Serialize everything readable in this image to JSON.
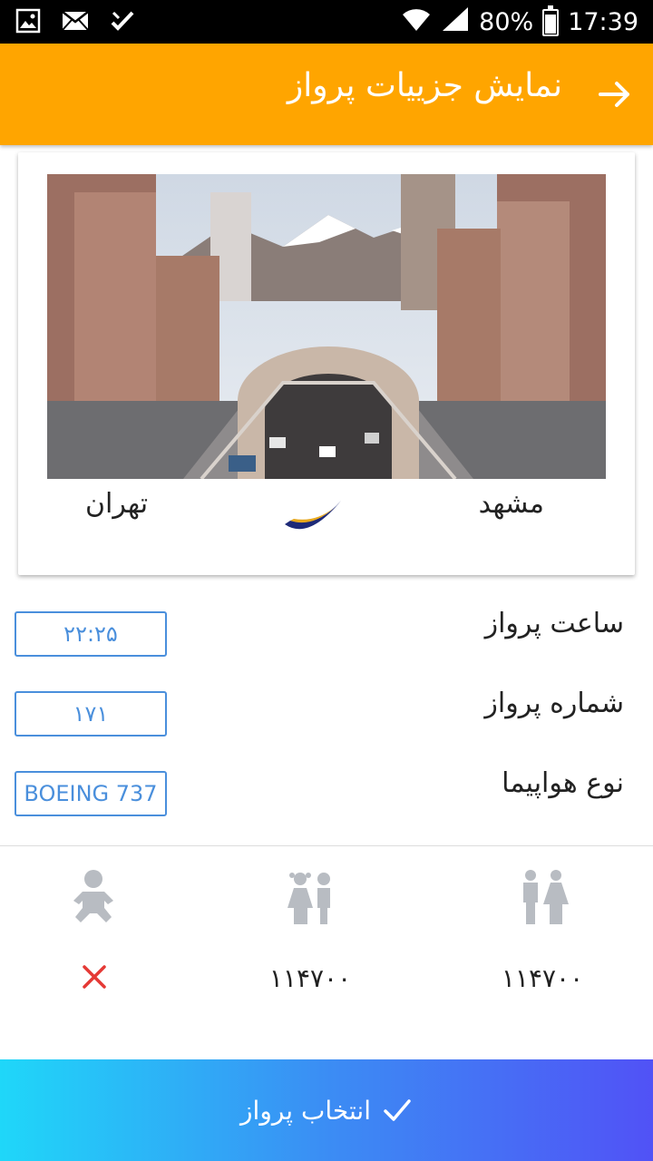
{
  "status_bar": {
    "battery": "80%",
    "time": "17:39"
  },
  "header": {
    "title": "نمایش جزییات پرواز",
    "color": "#FFA500"
  },
  "route": {
    "from": "مشهد",
    "to": "تهران"
  },
  "details": {
    "time_label": "ساعت پرواز",
    "time_value": "۲۲:۲۵",
    "number_label": "شماره پرواز",
    "number_value": "۱۷۱",
    "aircraft_label": "نوع هواپیما",
    "aircraft_value": "BOEING 737"
  },
  "prices": {
    "adult": "۱۱۴۷۰۰",
    "child": "۱۱۴۷۰۰",
    "infant_available": false
  },
  "notice": "",
  "select_button": {
    "label": "انتخاب پرواز"
  },
  "icons": [
    "image-icon",
    "mail-icon",
    "check-notification-icon",
    "wifi-icon",
    "signal-icon",
    "battery-icon",
    "back-arrow-icon",
    "airline-logo",
    "adult-icon",
    "child-icon",
    "infant-icon",
    "close-icon",
    "check-icon"
  ]
}
